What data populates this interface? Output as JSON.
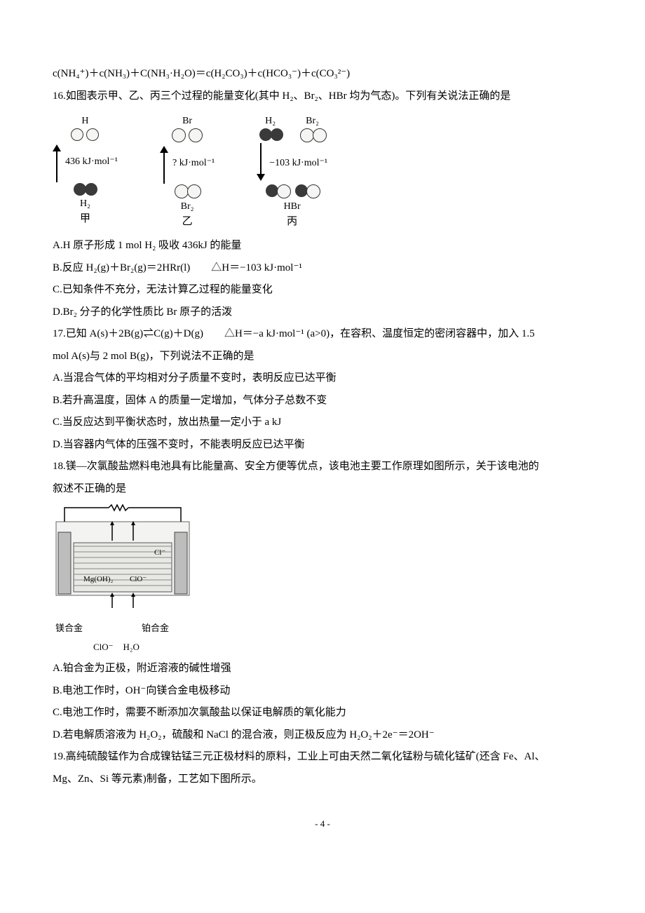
{
  "top_formula": "c(NH₄⁺)＋c(NH₃)＋C(NH₃·H₂O)＝c(H₂CO₃)＋c(HCO₃⁻)＋c(CO₃²⁻)",
  "q16": {
    "stem": "16.如图表示甲、乙、丙三个过程的能量变化(其中 H₂、Br₂、HBr 均为气态)。下列有关说法正确的是",
    "diag_jia": {
      "top": "H",
      "energy": "436 kJ·mol⁻¹",
      "bottom": "H₂",
      "caption": "甲"
    },
    "diag_yi": {
      "top": "Br",
      "energy": "? kJ·mol⁻¹",
      "bottom": "Br₂",
      "caption": "乙"
    },
    "diag_bing": {
      "top1": "H₂",
      "top2": "Br₂",
      "energy": "−103 kJ·mol⁻¹",
      "bottom": "HBr",
      "caption": "丙"
    },
    "A": "A.H 原子形成 1 mol H₂ 吸收 436kJ 的能量",
    "B": "B.反应 H₂(g)＋Br₂(g)＝2HRr(l)　　△H＝−103 kJ·mol⁻¹",
    "C": "C.已知条件不充分，无法计算乙过程的能量变化",
    "D": "D.Br₂ 分子的化学性质比 Br 原子的活泼"
  },
  "q17": {
    "stem1": "17.已知 A(s)＋2B(g)⇌C(g)＋D(g)　　△H＝−a kJ·mol⁻¹ (a>0)，在容积、温度恒定的密闭容器中，加入 1.5",
    "stem2": "mol A(s)与 2 mol B(g)，下列说法不正确的是",
    "A": "A.当混合气体的平均相对分子质量不变时，表明反应已达平衡",
    "B": "B.若升高温度，固体 A 的质量一定增加，气体分子总数不变",
    "C": "C.当反应达到平衡状态时，放出热量一定小于 a kJ",
    "D": "D.当容器内气体的压强不变时，不能表明反应已达平衡"
  },
  "q18": {
    "stem1": "18.镁—次氯酸盐燃料电池具有比能量高、安全方便等优点，该电池主要工作原理如图所示，关于该电池的",
    "stem2": "叙述不正确的是",
    "cell": {
      "clminus": "Cl⁻",
      "mgoh2": "Mg(OH)₂",
      "clo": "ClO⁻",
      "left_electrode": "镁合金",
      "right_electrode": "铂合金",
      "bottom_left": "ClO⁻",
      "bottom_right": "H₂O"
    },
    "A": "A.铂合金为正极，附近溶液的碱性增强",
    "B": "B.电池工作时，OH⁻向镁合金电极移动",
    "C": "C.电池工作时，需要不断添加次氯酸盐以保证电解质的氧化能力",
    "D": "D.若电解质溶液为 H₂O₂，硫酸和 NaCl 的混合液，则正极反应为 H₂O₂＋2e⁻＝2OH⁻"
  },
  "q19": {
    "stem1": "19.高纯硫酸锰作为合成镍钴锰三元正极材料的原料，工业上可由天然二氧化锰粉与硫化锰矿(还含 Fe、Al、",
    "stem2": "Mg、Zn、Si 等元素)制备，工艺如下图所示。"
  },
  "page_num": "- 4 -"
}
